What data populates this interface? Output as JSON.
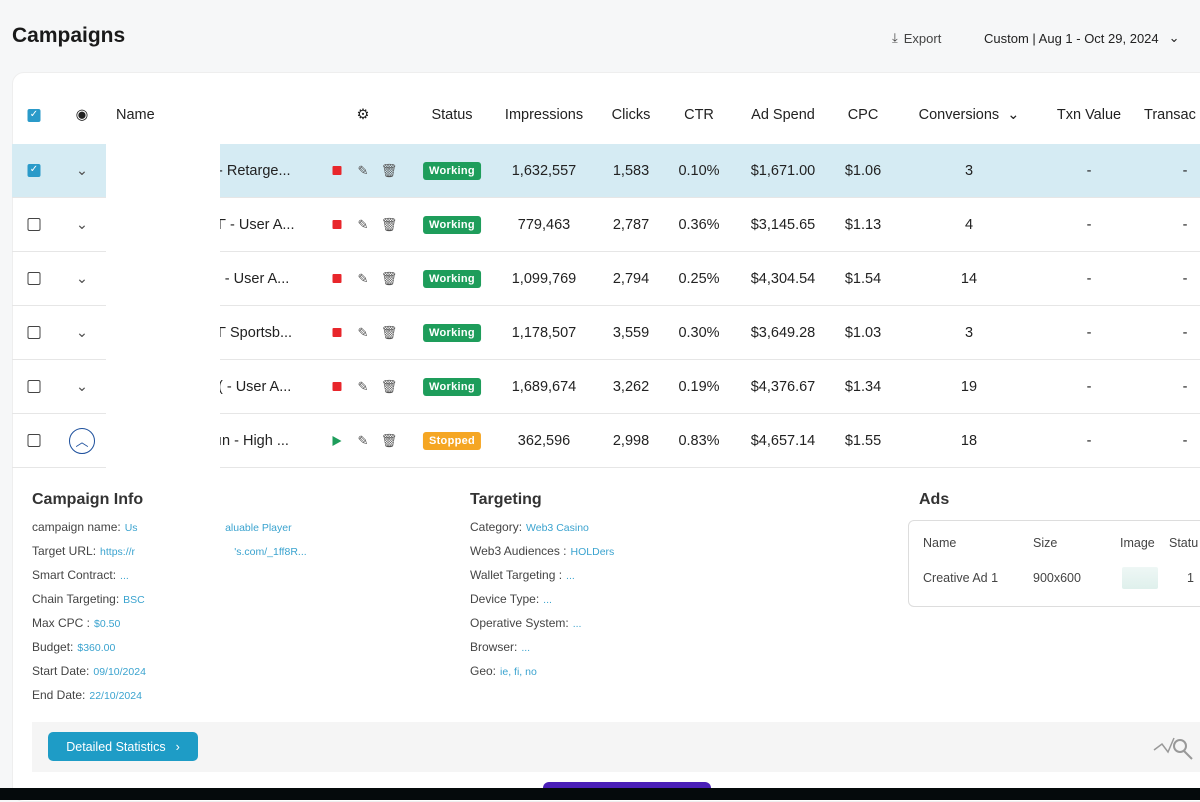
{
  "header": {
    "title": "Campaigns",
    "export_label": "Export",
    "date_range": "Custom | Aug 1 - Oct 29, 2024"
  },
  "table": {
    "columns": [
      "Name",
      "Status",
      "Impressions",
      "Clicks",
      "CTR",
      "Ad Spend",
      "CPC",
      "Conversions",
      "Txn Value",
      "Transac"
    ],
    "rows": [
      {
        "name": "- Retarge...",
        "status": "Working",
        "impressions": "1,632,557",
        "clicks": "1,583",
        "ctr": "0.10%",
        "ad_spend": "$1,671.00",
        "cpc": "$1.06",
        "conversions": "3",
        "txn_value": "-",
        "transac": "-",
        "selected": true,
        "running": true
      },
      {
        "name": "Γ - User A...",
        "status": "Working",
        "impressions": "779,463",
        "clicks": "2,787",
        "ctr": "0.36%",
        "ad_spend": "$3,145.65",
        "cpc": "$1.13",
        "conversions": "4",
        "txn_value": "-",
        "transac": "-",
        "selected": false,
        "running": true
      },
      {
        "name": "' - User A...",
        "status": "Working",
        "impressions": "1,099,769",
        "clicks": "2,794",
        "ctr": "0.25%",
        "ad_spend": "$4,304.54",
        "cpc": "$1.54",
        "conversions": "14",
        "txn_value": "-",
        "transac": "-",
        "selected": false,
        "running": true
      },
      {
        "name": "Γ Sportsb...",
        "status": "Working",
        "impressions": "1,178,507",
        "clicks": "3,559",
        "ctr": "0.30%",
        "ad_spend": "$3,649.28",
        "cpc": "$1.03",
        "conversions": "3",
        "txn_value": "-",
        "transac": "-",
        "selected": false,
        "running": true
      },
      {
        "name": "( - User A...",
        "status": "Working",
        "impressions": "1,689,674",
        "clicks": "3,262",
        "ctr": "0.19%",
        "ad_spend": "$4,376.67",
        "cpc": "$1.34",
        "conversions": "19",
        "txn_value": "-",
        "transac": "-",
        "selected": false,
        "running": true
      },
      {
        "name": "ın - High ...",
        "status": "Stopped",
        "impressions": "362,596",
        "clicks": "2,998",
        "ctr": "0.83%",
        "ad_spend": "$4,657.14",
        "cpc": "$1.55",
        "conversions": "18",
        "txn_value": "-",
        "transac": "-",
        "selected": false,
        "running": false,
        "expanded": true
      }
    ]
  },
  "details": {
    "campaign_info": {
      "title": "Campaign Info",
      "items": [
        {
          "label": "campaign name:",
          "value": "Us                              aluable Player"
        },
        {
          "label": "Target URL:",
          "value": "https://r                                  's.com/_1ff8R..."
        },
        {
          "label": "Smart Contract:",
          "value": "..."
        },
        {
          "label": "Chain Targeting:",
          "value": "BSC"
        },
        {
          "label": "Max CPC :",
          "value": "$0.50"
        },
        {
          "label": "Budget:",
          "value": "$360.00"
        },
        {
          "label": "Start Date:",
          "value": "09/10/2024"
        },
        {
          "label": "End Date:",
          "value": "22/10/2024"
        }
      ]
    },
    "targeting": {
      "title": "Targeting",
      "items": [
        {
          "label": "Category:",
          "value": "Web3 Casino"
        },
        {
          "label": "Web3 Audiences :",
          "value": "HOLDers"
        },
        {
          "label": "Wallet Targeting :",
          "value": "..."
        },
        {
          "label": "Device Type:",
          "value": "..."
        },
        {
          "label": "Operative System:",
          "value": "..."
        },
        {
          "label": "Browser:",
          "value": "..."
        },
        {
          "label": "Geo:",
          "value": "ie, fi, no"
        }
      ]
    },
    "ads": {
      "title": "Ads",
      "columns": [
        "Name",
        "Size",
        "Image",
        "Statu"
      ],
      "row": {
        "name": "Creative Ad 1",
        "size": "900x600",
        "status": "1"
      }
    },
    "detailed_stats_label": "Detailed Statistics"
  },
  "colors": {
    "accent": "#1e9cc6",
    "working": "#1e9d5b",
    "stopped": "#f5a623",
    "selected_row": "#d5ebf3"
  }
}
